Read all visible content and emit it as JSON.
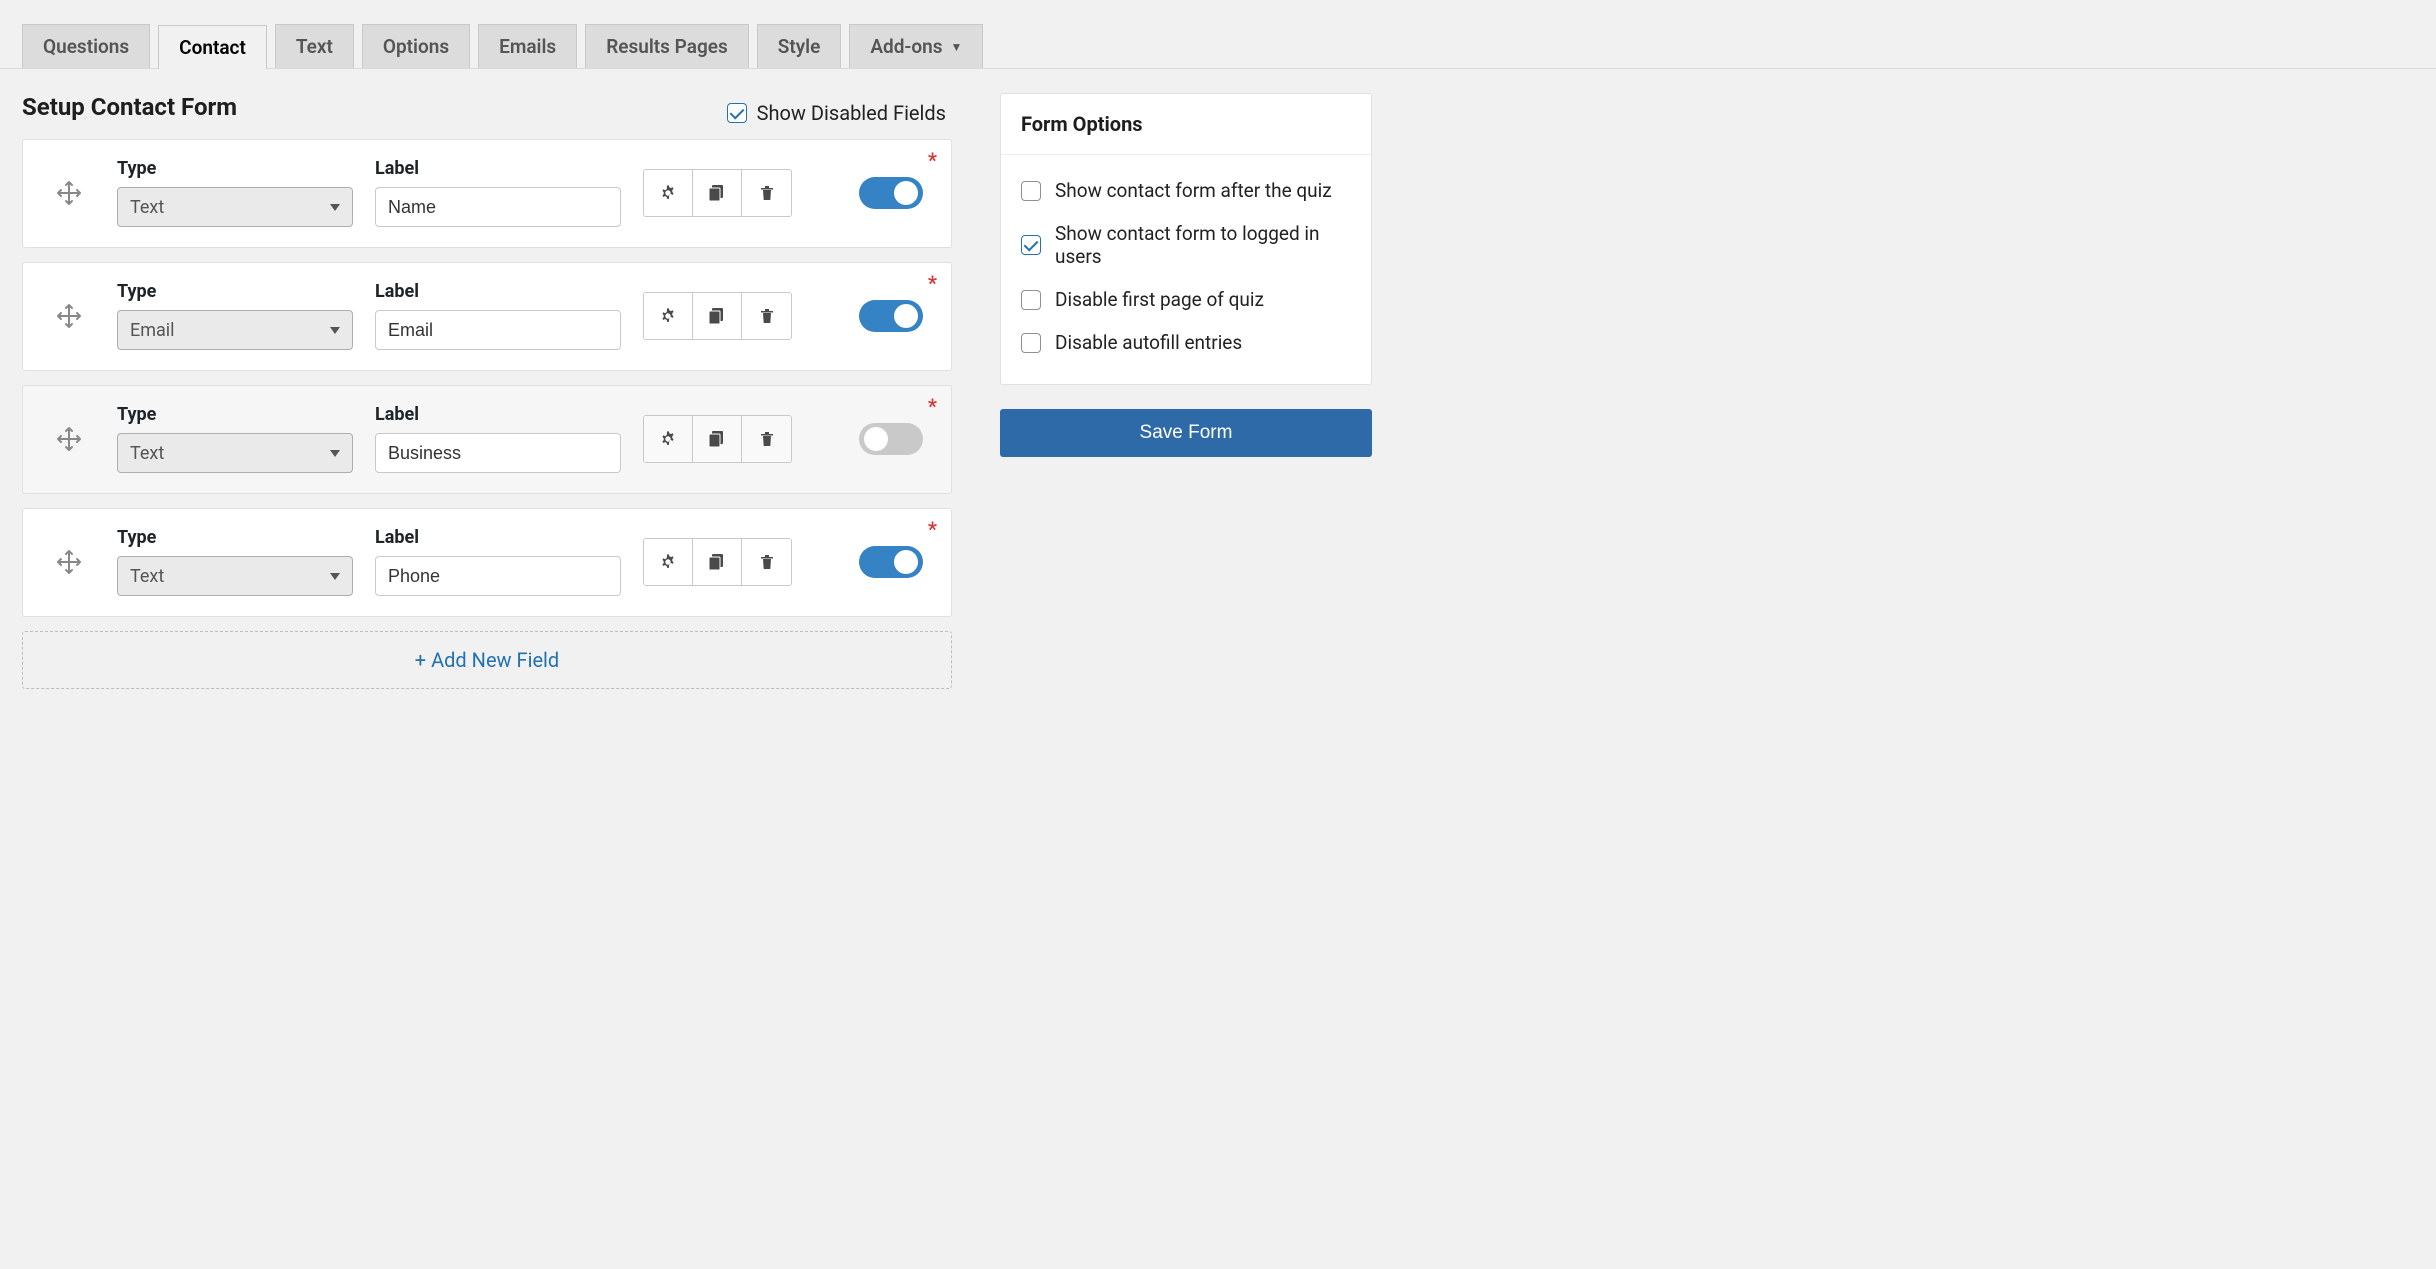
{
  "tabs": [
    {
      "id": "questions",
      "label": "Questions",
      "active": false
    },
    {
      "id": "contact",
      "label": "Contact",
      "active": true
    },
    {
      "id": "text",
      "label": "Text",
      "active": false
    },
    {
      "id": "options",
      "label": "Options",
      "active": false
    },
    {
      "id": "emails",
      "label": "Emails",
      "active": false
    },
    {
      "id": "results",
      "label": "Results Pages",
      "active": false
    },
    {
      "id": "style",
      "label": "Style",
      "active": false
    },
    {
      "id": "addons",
      "label": "Add-ons",
      "active": false,
      "dropdown": true
    }
  ],
  "page_title": "Setup Contact Form",
  "show_disabled": {
    "label": "Show Disabled Fields",
    "checked": true
  },
  "field_header": {
    "type": "Type",
    "label": "Label"
  },
  "fields": [
    {
      "type": "Text",
      "label": "Name",
      "required": true,
      "enabled": true
    },
    {
      "type": "Email",
      "label": "Email",
      "required": true,
      "enabled": true
    },
    {
      "type": "Text",
      "label": "Business",
      "required": true,
      "enabled": false
    },
    {
      "type": "Text",
      "label": "Phone",
      "required": true,
      "enabled": true
    }
  ],
  "add_new_label": "+ Add New Field",
  "form_options": {
    "title": "Form Options",
    "items": [
      {
        "label": "Show contact form after the quiz",
        "checked": false
      },
      {
        "label": "Show contact form to logged in users",
        "checked": true
      },
      {
        "label": "Disable first page of quiz",
        "checked": false
      },
      {
        "label": "Disable autofill entries",
        "checked": false
      }
    ]
  },
  "save_label": "Save Form"
}
